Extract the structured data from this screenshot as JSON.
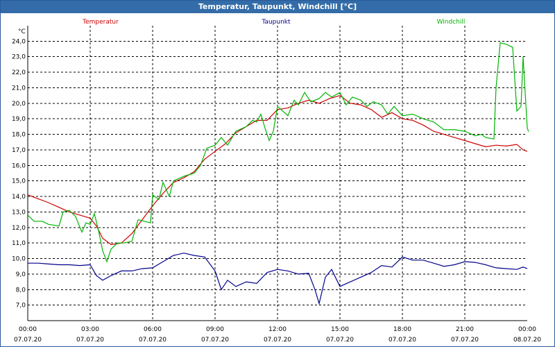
{
  "window": {
    "title": "Temperatur, Taupunkt, Windchill [°C]"
  },
  "chart_data": {
    "type": "line",
    "title": "Temperatur, Taupunkt, Windchill [°C]",
    "ylabel": "°C",
    "xlabel": "",
    "ylim": [
      6.0,
      25.0
    ],
    "y_ticks": [
      "7,0",
      "8,0",
      "9,0",
      "10,0",
      "11,0",
      "12,0",
      "13,0",
      "14,0",
      "15,0",
      "16,0",
      "17,0",
      "18,0",
      "19,0",
      "20,0",
      "21,0",
      "22,0",
      "23,0",
      "24,0"
    ],
    "x_range_hours": [
      0,
      24
    ],
    "x_ticks": [
      {
        "time": "00:00",
        "date": "07.07.20"
      },
      {
        "time": "03:00",
        "date": "07.07.20"
      },
      {
        "time": "06:00",
        "date": "07.07.20"
      },
      {
        "time": "09:00",
        "date": "07.07.20"
      },
      {
        "time": "12:00",
        "date": "07.07.20"
      },
      {
        "time": "15:00",
        "date": "07.07.20"
      },
      {
        "time": "18:00",
        "date": "07.07.20"
      },
      {
        "time": "21:00",
        "date": "07.07.20"
      },
      {
        "time": "00:00",
        "date": "08.07.20"
      }
    ],
    "grid": true,
    "legend_position": "top",
    "series": [
      {
        "name": "Temperatur",
        "color": "#cc0000",
        "points": [
          [
            0.0,
            14.1
          ],
          [
            0.5,
            13.85
          ],
          [
            1.0,
            13.6
          ],
          [
            1.5,
            13.3
          ],
          [
            2.0,
            13.0
          ],
          [
            2.5,
            12.8
          ],
          [
            3.0,
            12.6
          ],
          [
            3.3,
            12.1
          ],
          [
            3.6,
            11.3
          ],
          [
            4.0,
            10.9
          ],
          [
            4.5,
            11.0
          ],
          [
            5.0,
            11.6
          ],
          [
            5.5,
            12.5
          ],
          [
            6.0,
            13.4
          ],
          [
            6.5,
            14.2
          ],
          [
            7.0,
            14.9
          ],
          [
            7.5,
            15.2
          ],
          [
            8.0,
            15.6
          ],
          [
            8.5,
            16.4
          ],
          [
            9.0,
            16.9
          ],
          [
            9.5,
            17.4
          ],
          [
            10.0,
            18.1
          ],
          [
            10.5,
            18.5
          ],
          [
            11.0,
            18.9
          ],
          [
            11.5,
            18.9
          ],
          [
            12.0,
            19.6
          ],
          [
            12.5,
            19.7
          ],
          [
            13.0,
            20.0
          ],
          [
            13.5,
            20.2
          ],
          [
            14.0,
            20.0
          ],
          [
            14.5,
            20.3
          ],
          [
            15.0,
            20.5
          ],
          [
            15.5,
            20.0
          ],
          [
            16.0,
            19.9
          ],
          [
            16.5,
            19.6
          ],
          [
            17.0,
            19.1
          ],
          [
            17.5,
            19.4
          ],
          [
            18.0,
            19.0
          ],
          [
            18.5,
            18.9
          ],
          [
            19.0,
            18.6
          ],
          [
            19.5,
            18.2
          ],
          [
            20.0,
            18.0
          ],
          [
            20.5,
            17.8
          ],
          [
            21.0,
            17.6
          ],
          [
            21.5,
            17.4
          ],
          [
            22.0,
            17.2
          ],
          [
            22.5,
            17.3
          ],
          [
            23.0,
            17.25
          ],
          [
            23.5,
            17.35
          ],
          [
            23.8,
            17.0
          ],
          [
            24.0,
            16.9
          ]
        ]
      },
      {
        "name": "Taupunkt",
        "color": "#00008c",
        "points": [
          [
            0.0,
            9.7
          ],
          [
            0.5,
            9.7
          ],
          [
            1.0,
            9.65
          ],
          [
            1.5,
            9.6
          ],
          [
            2.0,
            9.6
          ],
          [
            2.5,
            9.55
          ],
          [
            3.0,
            9.6
          ],
          [
            3.3,
            8.9
          ],
          [
            3.6,
            8.6
          ],
          [
            4.0,
            8.9
          ],
          [
            4.5,
            9.2
          ],
          [
            5.0,
            9.2
          ],
          [
            5.5,
            9.35
          ],
          [
            6.0,
            9.4
          ],
          [
            6.5,
            9.8
          ],
          [
            7.0,
            10.2
          ],
          [
            7.5,
            10.35
          ],
          [
            8.0,
            10.2
          ],
          [
            8.5,
            10.1
          ],
          [
            9.0,
            9.2
          ],
          [
            9.3,
            8.0
          ],
          [
            9.6,
            8.6
          ],
          [
            10.0,
            8.2
          ],
          [
            10.5,
            8.5
          ],
          [
            11.0,
            8.4
          ],
          [
            11.5,
            9.1
          ],
          [
            12.0,
            9.3
          ],
          [
            12.5,
            9.2
          ],
          [
            13.0,
            9.0
          ],
          [
            13.5,
            9.05
          ],
          [
            13.8,
            8.0
          ],
          [
            14.0,
            7.1
          ],
          [
            14.3,
            8.8
          ],
          [
            14.6,
            9.3
          ],
          [
            15.0,
            8.2
          ],
          [
            15.5,
            8.5
          ],
          [
            16.0,
            8.8
          ],
          [
            16.5,
            9.1
          ],
          [
            17.0,
            9.55
          ],
          [
            17.5,
            9.45
          ],
          [
            18.0,
            10.1
          ],
          [
            18.5,
            9.9
          ],
          [
            19.0,
            9.9
          ],
          [
            19.5,
            9.7
          ],
          [
            20.0,
            9.5
          ],
          [
            20.5,
            9.6
          ],
          [
            21.0,
            9.8
          ],
          [
            21.5,
            9.75
          ],
          [
            22.0,
            9.6
          ],
          [
            22.5,
            9.4
          ],
          [
            23.0,
            9.35
          ],
          [
            23.5,
            9.3
          ],
          [
            23.8,
            9.45
          ],
          [
            24.0,
            9.35
          ]
        ]
      },
      {
        "name": "Windchill",
        "color": "#00b400",
        "points": [
          [
            0.0,
            12.8
          ],
          [
            0.3,
            12.4
          ],
          [
            0.7,
            12.4
          ],
          [
            1.0,
            12.2
          ],
          [
            1.5,
            12.1
          ],
          [
            1.7,
            13.0
          ],
          [
            2.0,
            13.1
          ],
          [
            2.3,
            12.7
          ],
          [
            2.6,
            11.7
          ],
          [
            2.8,
            12.3
          ],
          [
            3.0,
            12.2
          ],
          [
            3.2,
            12.9
          ],
          [
            3.4,
            11.8
          ],
          [
            3.6,
            10.5
          ],
          [
            3.8,
            9.8
          ],
          [
            4.0,
            10.6
          ],
          [
            4.3,
            11.0
          ],
          [
            4.6,
            11.0
          ],
          [
            5.0,
            11.1
          ],
          [
            5.3,
            12.5
          ],
          [
            5.6,
            12.4
          ],
          [
            5.9,
            12.3
          ],
          [
            6.0,
            14.1
          ],
          [
            6.3,
            13.8
          ],
          [
            6.5,
            14.9
          ],
          [
            6.8,
            14.0
          ],
          [
            7.0,
            15.0
          ],
          [
            7.5,
            15.3
          ],
          [
            8.0,
            15.5
          ],
          [
            8.3,
            16.0
          ],
          [
            8.6,
            17.1
          ],
          [
            9.0,
            17.3
          ],
          [
            9.3,
            17.8
          ],
          [
            9.6,
            17.3
          ],
          [
            10.0,
            18.2
          ],
          [
            10.5,
            18.5
          ],
          [
            10.8,
            18.9
          ],
          [
            11.0,
            18.8
          ],
          [
            11.2,
            19.3
          ],
          [
            11.4,
            18.4
          ],
          [
            11.6,
            17.6
          ],
          [
            11.8,
            18.2
          ],
          [
            12.0,
            19.8
          ],
          [
            12.5,
            19.2
          ],
          [
            12.8,
            20.2
          ],
          [
            13.0,
            19.9
          ],
          [
            13.3,
            20.7
          ],
          [
            13.6,
            20.1
          ],
          [
            14.0,
            20.3
          ],
          [
            14.3,
            20.7
          ],
          [
            14.6,
            20.4
          ],
          [
            15.0,
            20.7
          ],
          [
            15.3,
            19.9
          ],
          [
            15.6,
            20.4
          ],
          [
            16.0,
            20.2
          ],
          [
            16.3,
            19.8
          ],
          [
            16.6,
            20.1
          ],
          [
            17.0,
            19.9
          ],
          [
            17.3,
            19.3
          ],
          [
            17.6,
            19.8
          ],
          [
            18.0,
            19.2
          ],
          [
            18.5,
            19.3
          ],
          [
            19.0,
            19.0
          ],
          [
            19.5,
            18.8
          ],
          [
            20.0,
            18.3
          ],
          [
            20.5,
            18.3
          ],
          [
            21.0,
            18.2
          ],
          [
            21.5,
            17.9
          ],
          [
            21.8,
            18.0
          ],
          [
            22.0,
            17.8
          ],
          [
            22.4,
            17.7
          ],
          [
            22.5,
            21.0
          ],
          [
            22.7,
            23.9
          ],
          [
            23.0,
            23.8
          ],
          [
            23.3,
            23.6
          ],
          [
            23.5,
            19.5
          ],
          [
            23.7,
            19.8
          ],
          [
            23.8,
            23.0
          ],
          [
            24.0,
            18.4
          ],
          [
            24.3,
            17.4
          ]
        ]
      }
    ]
  }
}
